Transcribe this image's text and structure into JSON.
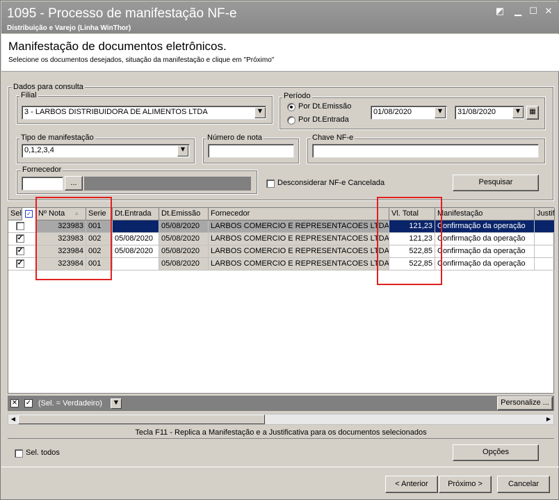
{
  "window": {
    "title": "1095 - Processo de manifestação NF-e",
    "subtitle": "Distribuição e Varejo (Linha WinThor)"
  },
  "header": {
    "title": "Manifestação de documentos eletrônicos.",
    "instructions": "Selecione os documentos desejados, situação da manifestação e clique em \"Próximo\""
  },
  "consulta": {
    "legend": "Dados para consulta",
    "filial": {
      "label": "Filial",
      "value": "3 - LARBOS DISTRIBUIDORA DE ALIMENTOS LTDA"
    },
    "periodo": {
      "label": "Período",
      "opt_emissao": "Por Dt.Emissão",
      "opt_entrada": "Por Dt.Entrada",
      "selected": "emissao",
      "date_start": "01/08/2020",
      "date_end": "31/08/2020"
    },
    "tipo": {
      "label": "Tipo de manifestação",
      "value": "0,1,2,3,4"
    },
    "numero_nota": {
      "label": "Número de nota",
      "value": ""
    },
    "chave": {
      "label": "Chave NF-e",
      "value": ""
    },
    "fornecedor": {
      "label": "Fornecedor",
      "value": "",
      "browse": "..."
    },
    "desconsiderar_label": "Desconsiderar NF-e Cancelada",
    "desconsiderar_checked": false,
    "pesquisar": "Pesquisar"
  },
  "grid": {
    "columns": [
      "Sel.",
      "Nº Nota",
      "Serie",
      "Dt.Entrada",
      "Dt.Emissão",
      "Fornecedor",
      "Vl. Total",
      "Manifestação",
      "Justif"
    ],
    "rows": [
      {
        "sel": true,
        "nota": "323983",
        "serie": "001",
        "dt_entrada": "",
        "dt_emissao": "05/08/2020",
        "fornecedor": "LARBOS COMERCIO E REPRESENTACOES LTDA",
        "total": "121,23",
        "manifestacao": "Confirmação da operação",
        "selected": true
      },
      {
        "sel": true,
        "nota": "323983",
        "serie": "002",
        "dt_entrada": "05/08/2020",
        "dt_emissao": "05/08/2020",
        "fornecedor": "LARBOS COMERCIO E REPRESENTACOES LTDA",
        "total": "121,23",
        "manifestacao": "Confirmação da operação",
        "selected": false
      },
      {
        "sel": true,
        "nota": "323984",
        "serie": "002",
        "dt_entrada": "05/08/2020",
        "dt_emissao": "05/08/2020",
        "fornecedor": "LARBOS COMERCIO E REPRESENTACOES LTDA",
        "total": "522,85",
        "manifestacao": "Confirmação da operação",
        "selected": false
      },
      {
        "sel": true,
        "nota": "323984",
        "serie": "001",
        "dt_entrada": "",
        "dt_emissao": "05/08/2020",
        "fornecedor": "LARBOS COMERCIO E REPRESENTACOES LTDA",
        "total": "522,85",
        "manifestacao": "Confirmação da operação",
        "selected": false
      }
    ]
  },
  "filter": {
    "text": "(Sel. = Verdadeiro)",
    "personalize": "Personalize ..."
  },
  "hint": "Tecla F11 - Replica a Manifestação e a Justificativa para os documentos selecionados",
  "footer": {
    "sel_todos": "Sel. todos",
    "opcoes": "Opções",
    "anterior": "< Anterior",
    "proximo": "Próximo >",
    "cancelar": "Cancelar"
  },
  "colors": {
    "titlebar": "#8c8c8c",
    "selection": "#0a246a",
    "highlight_box": "#e02020"
  }
}
